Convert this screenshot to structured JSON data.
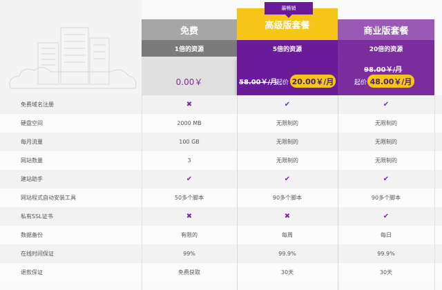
{
  "badge": "最畅销",
  "plans": [
    {
      "name": "免费",
      "resources": "1倍的资源",
      "price": "0.00￥"
    },
    {
      "name": "高级版套餐",
      "resources": "5倍的资源",
      "old_price": "58.00￥/月",
      "from_label": "起价",
      "price": "20.00￥/月"
    },
    {
      "name": "商业版套餐",
      "resources": "20倍的资源",
      "old_price": "98.00￥/月",
      "from_label": "起价",
      "price": "48.00￥/月"
    }
  ],
  "features": [
    {
      "name": "免费域名注册",
      "values": [
        "✖",
        "✔",
        "✔"
      ]
    },
    {
      "name": "硬盘空间",
      "values": [
        "2000 MB",
        "无限制的",
        "无限制的"
      ]
    },
    {
      "name": "每月流量",
      "values": [
        "100 GB",
        "无限制的",
        "无限制的"
      ]
    },
    {
      "name": "网站数量",
      "values": [
        "3",
        "无限制的",
        "无限制的"
      ]
    },
    {
      "name": "建站助手",
      "values": [
        "✔",
        "✔",
        "✔"
      ]
    },
    {
      "name": "网站程式自动安装工具",
      "values": [
        "50多个脚本",
        "90多个脚本",
        "90多个脚本"
      ]
    },
    {
      "name": "私有SSL证书",
      "values": [
        "✖",
        "✖",
        "✔"
      ]
    },
    {
      "name": "数据备份",
      "values": [
        "有限的",
        "每周",
        "每日"
      ]
    },
    {
      "name": "在线时间保证",
      "values": [
        "99%",
        "99.9%",
        "99.9%"
      ]
    },
    {
      "name": "退款保证",
      "values": [
        "免费获取",
        "30天",
        "30天"
      ]
    }
  ],
  "icons": {
    "check": "check-icon",
    "cross": "cross-icon"
  },
  "colors": {
    "purple": "#7b2d9e",
    "dark_purple": "#6a1b9a",
    "yellow": "#f5c518",
    "gray": "#a6a6a6"
  }
}
